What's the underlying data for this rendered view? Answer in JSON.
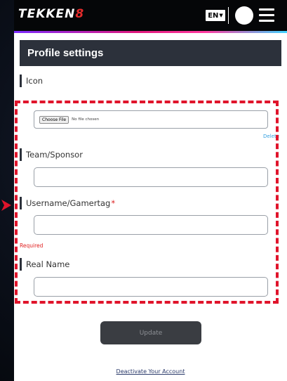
{
  "header": {
    "logo_main": "TEKKEN",
    "logo_num": "8",
    "language": "EN"
  },
  "panel": {
    "title": "Profile settings",
    "icon_label": "Icon",
    "file_button": "Choose File",
    "file_status": "No file chosen",
    "delete_label": "Delete",
    "team_label": "Team/Sponsor",
    "team_value": "",
    "username_label": "Username/Gamertag",
    "username_required_mark": "*",
    "username_value": "",
    "required_message": "Required",
    "realname_label": "Real Name",
    "realname_value": "",
    "update_label": "Update",
    "deactivate_label": "Deactivate Your Account"
  },
  "colors": {
    "annotation": "#e0142b",
    "title_bar": "#2c313b",
    "link": "#35a0e0",
    "error": "#e02020"
  }
}
